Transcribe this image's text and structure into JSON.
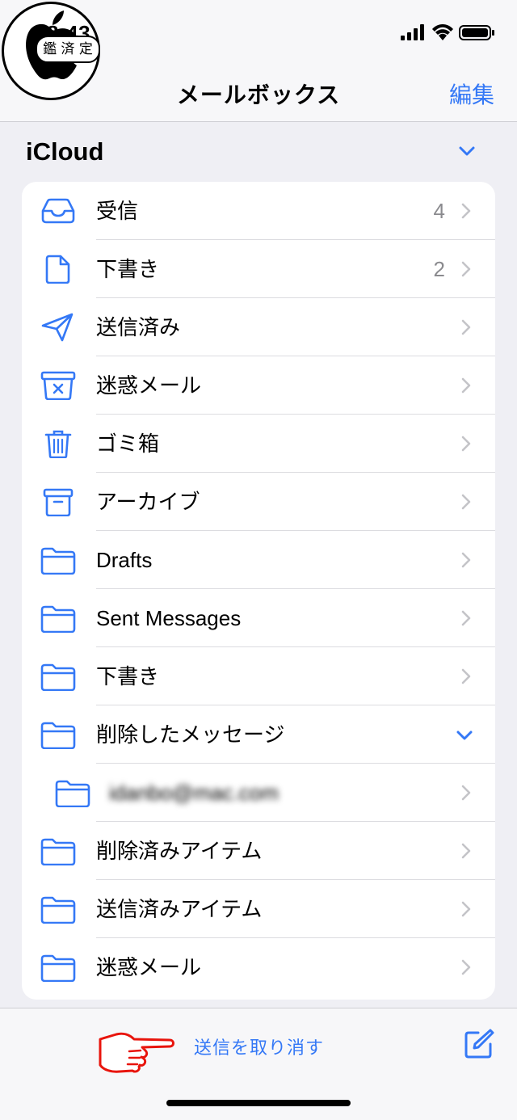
{
  "status_bar": {
    "time": "8:43",
    "stamp_text": "鑑 済 定"
  },
  "nav": {
    "title": "メールボックス",
    "edit_label": "編集"
  },
  "section": {
    "title": "iCloud"
  },
  "mailboxes": [
    {
      "label": "受信",
      "count": "4",
      "icon": "inbox-icon"
    },
    {
      "label": "下書き",
      "count": "2",
      "icon": "document-icon"
    },
    {
      "label": "送信済み",
      "count": "",
      "icon": "paper-plane-icon"
    },
    {
      "label": "迷惑メール",
      "count": "",
      "icon": "junk-icon"
    },
    {
      "label": "ゴミ箱",
      "count": "",
      "icon": "trash-icon"
    },
    {
      "label": "アーカイブ",
      "count": "",
      "icon": "archive-icon"
    },
    {
      "label": "Drafts",
      "count": "",
      "icon": "folder-icon"
    },
    {
      "label": "Sent Messages",
      "count": "",
      "icon": "folder-icon"
    },
    {
      "label": "下書き",
      "count": "",
      "icon": "folder-icon"
    },
    {
      "label": "削除したメッセージ",
      "count": "",
      "icon": "folder-icon",
      "expanded": true
    },
    {
      "label": "idanbo@mac.com",
      "count": "",
      "icon": "folder-icon",
      "blurred": true
    },
    {
      "label": "削除済みアイテム",
      "count": "",
      "icon": "folder-icon"
    },
    {
      "label": "送信済みアイテム",
      "count": "",
      "icon": "folder-icon"
    },
    {
      "label": "迷惑メール",
      "count": "",
      "icon": "folder-icon"
    }
  ],
  "toolbar": {
    "undo_send_label": "送信を取り消す"
  },
  "colors": {
    "accent": "#3478f6",
    "annotation": "#e8140c"
  }
}
